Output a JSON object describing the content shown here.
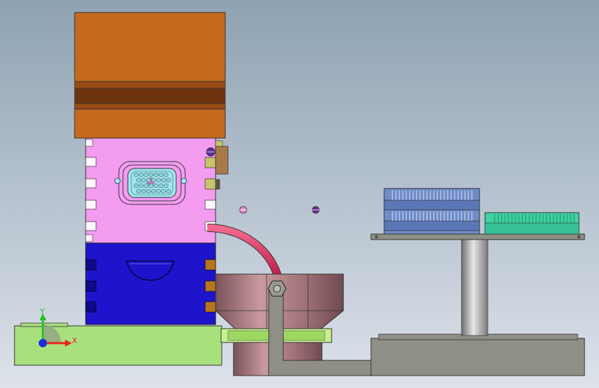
{
  "viewport": {
    "background_top": "#8ea2b3",
    "background_bottom": "#d9dee6"
  },
  "colors": {
    "orange_cover": "#c56a1c",
    "orange_dark": "#6e3410",
    "pink_mold": "#f39cf0",
    "blue_base": "#1d14cc",
    "mauve_bowl": "#a77b80",
    "green_ring": "#c6f08e",
    "green_base": "#a9e07e",
    "gray_steel": "#8f8f86",
    "blue_rail": "#6f8cc9",
    "teal_part": "#3fd1a2",
    "red_hose": "#e2325e"
  },
  "triad": {
    "x_label": "X",
    "y_label": "Y",
    "x_color": "#e8221b",
    "y_color": "#22c02a",
    "z_color": "#1a2de0"
  },
  "icons": {
    "hex_nut": "hex-nut-icon",
    "screw": "screw-icon",
    "coordinate_triad": "coordinate-triad-icon"
  }
}
